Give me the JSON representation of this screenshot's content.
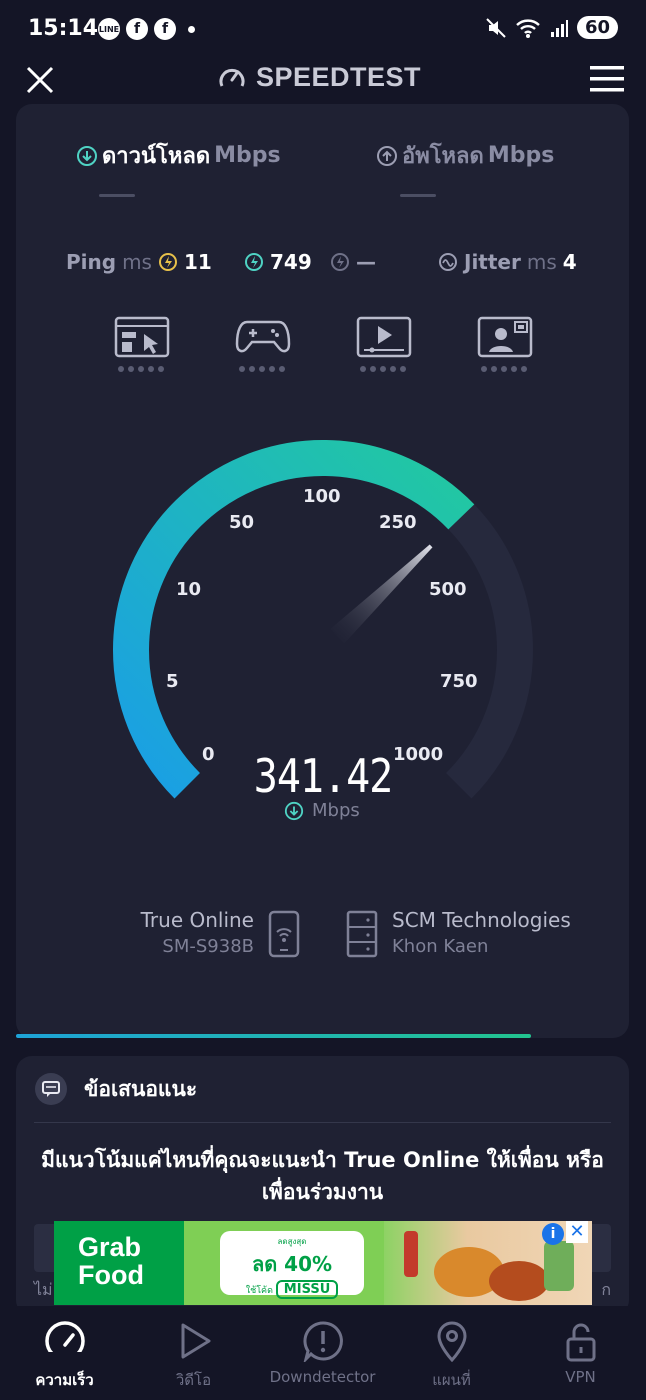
{
  "status_bar": {
    "time": "15:14",
    "app_icons": [
      "LINE",
      "f",
      "f"
    ],
    "battery": "60"
  },
  "topbar": {
    "brand": "SPEEDTEST"
  },
  "tabs": {
    "download_label": "ดาวน์โหลด",
    "download_unit": "Mbps",
    "upload_label": "อัพโหลด",
    "upload_unit": "Mbps"
  },
  "metrics": {
    "ping_label": "Ping",
    "ping_unit": "ms",
    "ping_idle": "11",
    "ping_download": "749",
    "ping_upload": "—",
    "jitter_label": "Jitter",
    "jitter_unit": "ms",
    "jitter_value": "4"
  },
  "usage_icons": [
    "browsing-icon",
    "gaming-icon",
    "video-streaming-icon",
    "video-call-icon"
  ],
  "gauge": {
    "ticks": [
      "0",
      "5",
      "10",
      "50",
      "100",
      "250",
      "500",
      "750",
      "1000"
    ],
    "value": "341.42",
    "unit": "Mbps",
    "needle_value": 341.42,
    "colors": {
      "arc_start": "#1a9ee6",
      "arc_end": "#22c9a0",
      "track": "#26293d"
    }
  },
  "connection": {
    "isp_name": "True Online",
    "device": "SM-S938B",
    "server_name": "SCM Technologies",
    "server_location": "Khon Kaen"
  },
  "progress": {
    "fraction": 0.84
  },
  "suggestion": {
    "title": "ข้อเสนอแนะ",
    "question": "มีแนวโน้มแค่ไหนที่คุณจะแนะนำ True Online ให้เพื่อน หรือเพื่อนร่วมงาน",
    "scale_left_fragment": "ไม่",
    "scale_right_fragment": "ก"
  },
  "ad": {
    "brand_line1": "Grab",
    "brand_line2": "Food",
    "small_text": "ลดสูงสุด",
    "discount": "ลด 40%",
    "code_prefix": "ใช้โค้ด",
    "code": "MISSU",
    "info": "i",
    "close": "✕"
  },
  "bottom_nav": [
    {
      "label": "ความเร็ว",
      "icon": "speedometer-icon",
      "active": true
    },
    {
      "label": "วิดีโอ",
      "icon": "play-icon",
      "active": false
    },
    {
      "label": "Downdetector",
      "icon": "alert-icon",
      "active": false
    },
    {
      "label": "แผนที่",
      "icon": "map-pin-icon",
      "active": false
    },
    {
      "label": "VPN",
      "icon": "lock-icon",
      "active": false
    }
  ]
}
